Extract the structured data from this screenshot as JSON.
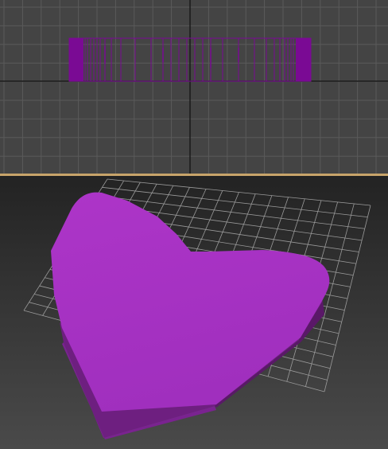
{
  "viewports": {
    "top": {
      "view": "orthographic-front",
      "grid": true
    },
    "perspective": {
      "view": "perspective",
      "grid": true,
      "active_border": true
    }
  },
  "object": {
    "shape": "heart",
    "extruded": true,
    "color": "#a633c2",
    "side_color": "#6e1f80",
    "wireframe_color": "#7a0a94"
  },
  "colors": {
    "viewport_bg": "#444444",
    "grid_line": "#5a5a5a",
    "grid_major": "#1a1a1a",
    "active_border": "#c8a46a",
    "persp_grid": "#9a9a9a"
  }
}
